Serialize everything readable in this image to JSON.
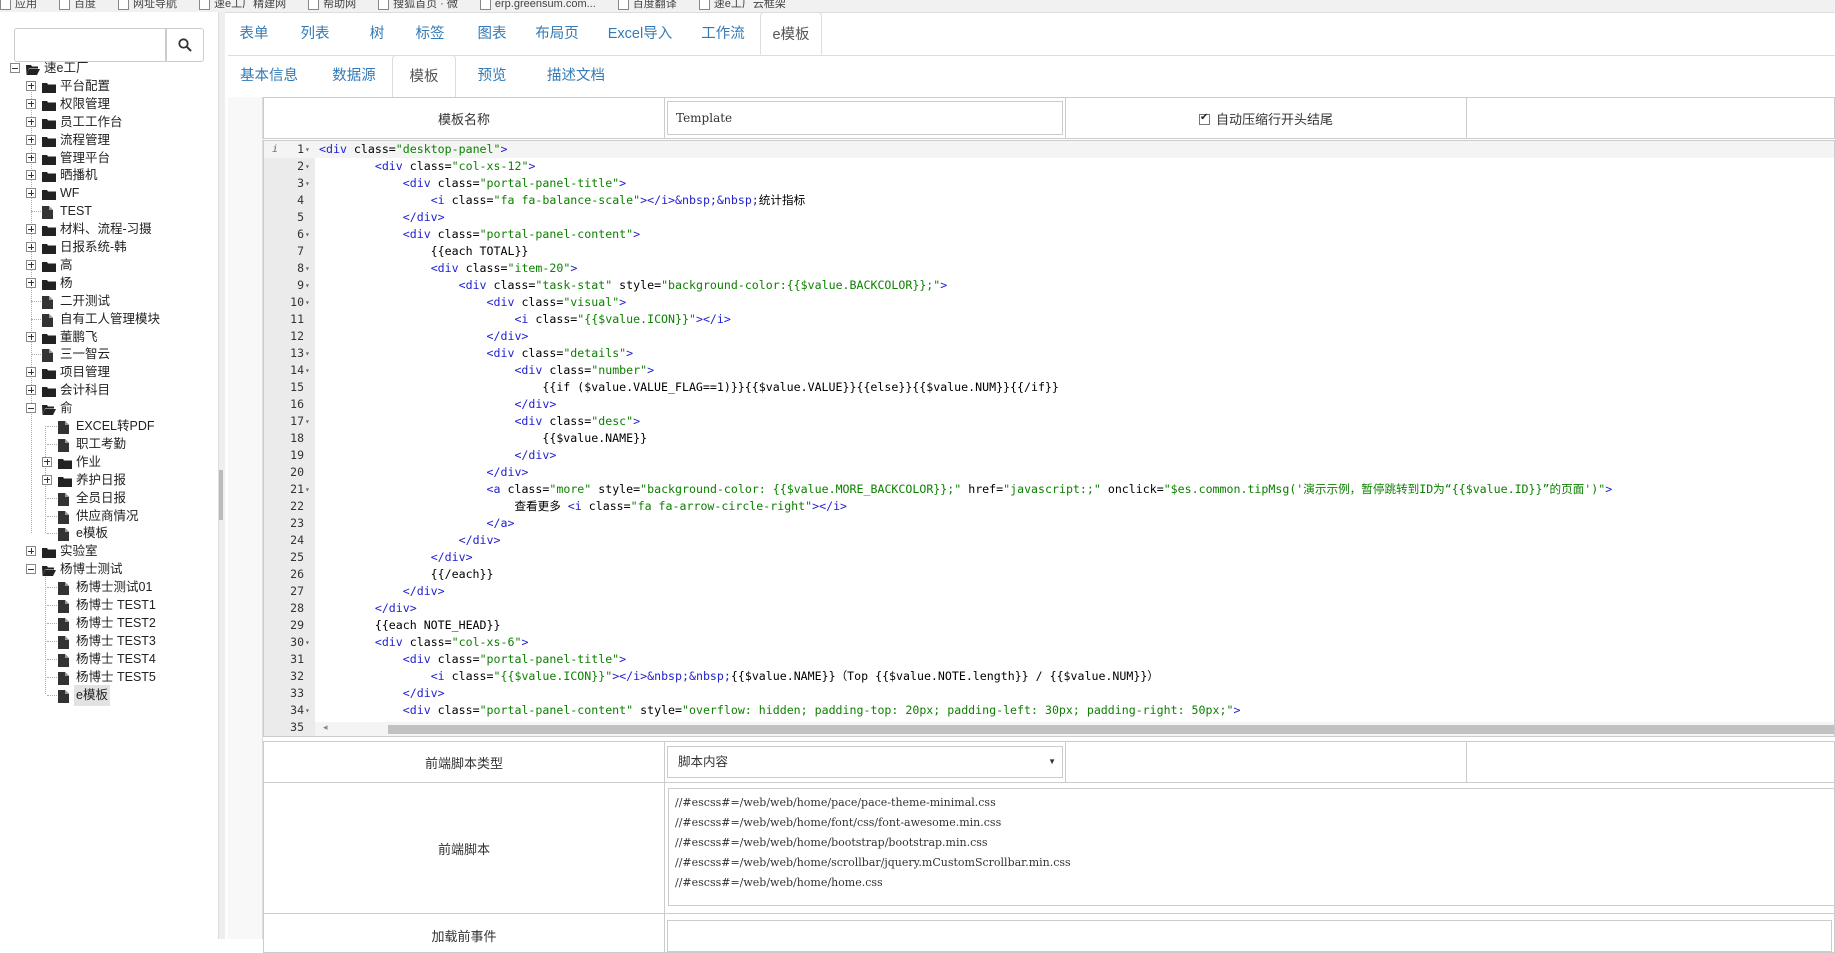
{
  "bookmarks": [
    "应用",
    "百度",
    "网址导航",
    "速e工厂精建网",
    "帮助网",
    "搜狐首页 · 微",
    "erp.greensum.com...",
    "百度翻译",
    "速e工厂云框架"
  ],
  "search": {
    "placeholder": ""
  },
  "tree": [
    {
      "label": "速e工厂",
      "icon": "folder-open",
      "toggle": "minus"
    },
    {
      "label": "平台配置",
      "icon": "folder",
      "toggle": "plus"
    },
    {
      "label": "权限管理",
      "icon": "folder",
      "toggle": "plus"
    },
    {
      "label": "员工工作台",
      "icon": "folder",
      "toggle": "plus"
    },
    {
      "label": "流程管理",
      "icon": "folder",
      "toggle": "plus"
    },
    {
      "label": "管理平台",
      "icon": "folder",
      "toggle": "plus"
    },
    {
      "label": "晒播机",
      "icon": "folder",
      "toggle": "plus"
    },
    {
      "label": "WF",
      "icon": "folder",
      "toggle": "plus"
    },
    {
      "label": "TEST",
      "icon": "file",
      "toggle": "none"
    },
    {
      "label": "材料、流程-习摄",
      "icon": "folder",
      "toggle": "plus"
    },
    {
      "label": "日报系统-韩",
      "icon": "folder",
      "toggle": "plus"
    },
    {
      "label": "高",
      "icon": "folder",
      "toggle": "plus"
    },
    {
      "label": "杨",
      "icon": "folder",
      "toggle": "plus"
    },
    {
      "label": "二开测试",
      "icon": "file",
      "toggle": "none"
    },
    {
      "label": "自有工人管理模块",
      "icon": "file",
      "toggle": "none"
    },
    {
      "label": "董鹏飞",
      "icon": "folder",
      "toggle": "plus"
    },
    {
      "label": "三一智云",
      "icon": "file",
      "toggle": "none"
    },
    {
      "label": "项目管理",
      "icon": "folder",
      "toggle": "plus"
    },
    {
      "label": "会计科目",
      "icon": "folder",
      "toggle": "plus"
    },
    {
      "label": "俞",
      "icon": "folder-open",
      "toggle": "minus"
    },
    {
      "label": "EXCEL转PDF",
      "icon": "file",
      "toggle": "none"
    },
    {
      "label": "职工考勤",
      "icon": "file",
      "toggle": "none"
    },
    {
      "label": "作业",
      "icon": "folder",
      "toggle": "plus"
    },
    {
      "label": "养护日报",
      "icon": "folder",
      "toggle": "plus"
    },
    {
      "label": "全员日报",
      "icon": "file",
      "toggle": "none"
    },
    {
      "label": "供应商情况",
      "icon": "file",
      "toggle": "none"
    },
    {
      "label": "e模板",
      "icon": "file",
      "toggle": "none"
    },
    {
      "label": "实验室",
      "icon": "folder",
      "toggle": "plus"
    },
    {
      "label": "杨博士测试",
      "icon": "folder-open",
      "toggle": "minus"
    },
    {
      "label": "杨博士测试01",
      "icon": "file",
      "toggle": "none"
    },
    {
      "label": "杨博士 TEST1",
      "icon": "file",
      "toggle": "none"
    },
    {
      "label": "杨博士 TEST2",
      "icon": "file",
      "toggle": "none"
    },
    {
      "label": "杨博士 TEST3",
      "icon": "file",
      "toggle": "none"
    },
    {
      "label": "杨博士 TEST4",
      "icon": "file",
      "toggle": "none"
    },
    {
      "label": "杨博士 TEST5",
      "icon": "file",
      "toggle": "none"
    },
    {
      "label": "e模板",
      "icon": "file",
      "toggle": "none",
      "selected": true
    }
  ],
  "main_tabs": [
    "表单",
    "列表",
    "树",
    "标签",
    "图表",
    "布局页",
    "Excel导入",
    "工作流",
    "e模板"
  ],
  "sub_tabs": [
    "基本信息",
    "数据源",
    "模板",
    "预览",
    "描述文档"
  ],
  "form": {
    "template_name_label": "模板名称",
    "template_name_value": "Template",
    "auto_compress_label": "自动压缩行开头结尾",
    "frontend_script_type_label": "前端脚本类型",
    "frontend_script_type_value": "脚本内容",
    "frontend_script_label": "前端脚本",
    "before_load_label": "加载前事件"
  },
  "frontend_script_lines": [
    "//#escss#=/web/web/home/pace/pace-theme-minimal.css",
    "//#escss#=/web/web/home/font/css/font-awesome.min.css",
    "//#escss#=/web/web/home/bootstrap/bootstrap.min.css",
    "//#escss#=/web/web/home/scrollbar/jquery.mCustomScrollbar.min.css",
    "//#escss#=/web/web/home/home.css"
  ],
  "code": {
    "line_count": 35,
    "fold_lines": [
      1,
      2,
      3,
      6,
      8,
      9,
      10,
      13,
      14,
      17,
      21,
      30,
      34
    ],
    "lines": [
      [
        [
          "tg",
          "<div "
        ],
        [
          "at",
          "class="
        ],
        [
          "st",
          "\"desktop-panel\""
        ],
        [
          "tg",
          ">"
        ]
      ],
      [
        [
          "tx",
          "        "
        ],
        [
          "tg",
          "<div "
        ],
        [
          "at",
          "class="
        ],
        [
          "st",
          "\"col-xs-12\""
        ],
        [
          "tg",
          ">"
        ]
      ],
      [
        [
          "tx",
          "            "
        ],
        [
          "tg",
          "<div "
        ],
        [
          "at",
          "class="
        ],
        [
          "st",
          "\"portal-panel-title\""
        ],
        [
          "tg",
          ">"
        ]
      ],
      [
        [
          "tx",
          "                "
        ],
        [
          "tg",
          "<i "
        ],
        [
          "at",
          "class="
        ],
        [
          "st",
          "\"fa fa-balance-scale\""
        ],
        [
          "tg",
          "></i>"
        ],
        [
          "tg",
          "&nbsp;&nbsp;"
        ],
        [
          "tx",
          "统计指标"
        ]
      ],
      [
        [
          "tx",
          "            "
        ],
        [
          "tg",
          "</div>"
        ]
      ],
      [
        [
          "tx",
          "            "
        ],
        [
          "tg",
          "<div "
        ],
        [
          "at",
          "class="
        ],
        [
          "st",
          "\"portal-panel-content\""
        ],
        [
          "tg",
          ">"
        ]
      ],
      [
        [
          "tx",
          "                {{each TOTAL}}"
        ]
      ],
      [
        [
          "tx",
          "                "
        ],
        [
          "tg",
          "<div "
        ],
        [
          "at",
          "class="
        ],
        [
          "st",
          "\"item-20\""
        ],
        [
          "tg",
          ">"
        ]
      ],
      [
        [
          "tx",
          "                    "
        ],
        [
          "tg",
          "<div "
        ],
        [
          "at",
          "class="
        ],
        [
          "st",
          "\"task-stat\""
        ],
        [
          "at",
          " style="
        ],
        [
          "st",
          "\"background-color:{{$value.BACKCOLOR}};\""
        ],
        [
          "tg",
          ">"
        ]
      ],
      [
        [
          "tx",
          "                        "
        ],
        [
          "tg",
          "<div "
        ],
        [
          "at",
          "class="
        ],
        [
          "st",
          "\"visual\""
        ],
        [
          "tg",
          ">"
        ]
      ],
      [
        [
          "tx",
          "                            "
        ],
        [
          "tg",
          "<i "
        ],
        [
          "at",
          "class="
        ],
        [
          "st",
          "\"{{$value.ICON}}\""
        ],
        [
          "tg",
          "></i>"
        ]
      ],
      [
        [
          "tx",
          "                        "
        ],
        [
          "tg",
          "</div>"
        ]
      ],
      [
        [
          "tx",
          "                        "
        ],
        [
          "tg",
          "<div "
        ],
        [
          "at",
          "class="
        ],
        [
          "st",
          "\"details\""
        ],
        [
          "tg",
          ">"
        ]
      ],
      [
        [
          "tx",
          "                            "
        ],
        [
          "tg",
          "<div "
        ],
        [
          "at",
          "class="
        ],
        [
          "st",
          "\"number\""
        ],
        [
          "tg",
          ">"
        ]
      ],
      [
        [
          "tx",
          "                                {{if ($value.VALUE_FLAG==1)}}{{$value.VALUE}}{{else}}{{$value.NUM}}{{/if}}"
        ]
      ],
      [
        [
          "tx",
          "                            "
        ],
        [
          "tg",
          "</div>"
        ]
      ],
      [
        [
          "tx",
          "                            "
        ],
        [
          "tg",
          "<div "
        ],
        [
          "at",
          "class="
        ],
        [
          "st",
          "\"desc\""
        ],
        [
          "tg",
          ">"
        ]
      ],
      [
        [
          "tx",
          "                                {{$value.NAME}}"
        ]
      ],
      [
        [
          "tx",
          "                            "
        ],
        [
          "tg",
          "</div>"
        ]
      ],
      [
        [
          "tx",
          "                        "
        ],
        [
          "tg",
          "</div>"
        ]
      ],
      [
        [
          "tx",
          "                        "
        ],
        [
          "tg",
          "<a "
        ],
        [
          "at",
          "class="
        ],
        [
          "st",
          "\"more\""
        ],
        [
          "at",
          " style="
        ],
        [
          "st",
          "\"background-color: {{$value.MORE_BACKCOLOR}};\""
        ],
        [
          "at",
          " href="
        ],
        [
          "st",
          "\"javascript:;\""
        ],
        [
          "at",
          " onclick="
        ],
        [
          "st",
          "\"$es.common.tipMsg('演示示例，暂停跳转到ID为“{{$value.ID}}”的页面')\""
        ],
        [
          "tg",
          ">"
        ]
      ],
      [
        [
          "tx",
          "                            查看更多 "
        ],
        [
          "tg",
          "<i "
        ],
        [
          "at",
          "class="
        ],
        [
          "st",
          "\"fa fa-arrow-circle-right\""
        ],
        [
          "tg",
          "></i>"
        ]
      ],
      [
        [
          "tx",
          "                        "
        ],
        [
          "tg",
          "</a>"
        ]
      ],
      [
        [
          "tx",
          "                    "
        ],
        [
          "tg",
          "</div>"
        ]
      ],
      [
        [
          "tx",
          "                "
        ],
        [
          "tg",
          "</div>"
        ]
      ],
      [
        [
          "tx",
          "                {{/each}}"
        ]
      ],
      [
        [
          "tx",
          "            "
        ],
        [
          "tg",
          "</div>"
        ]
      ],
      [
        [
          "tx",
          "        "
        ],
        [
          "tg",
          "</div>"
        ]
      ],
      [
        [
          "tx",
          "        {{each NOTE_HEAD}}"
        ]
      ],
      [
        [
          "tx",
          "        "
        ],
        [
          "tg",
          "<div "
        ],
        [
          "at",
          "class="
        ],
        [
          "st",
          "\"col-xs-6\""
        ],
        [
          "tg",
          ">"
        ]
      ],
      [
        [
          "tx",
          "            "
        ],
        [
          "tg",
          "<div "
        ],
        [
          "at",
          "class="
        ],
        [
          "st",
          "\"portal-panel-title\""
        ],
        [
          "tg",
          ">"
        ]
      ],
      [
        [
          "tx",
          "                "
        ],
        [
          "tg",
          "<i "
        ],
        [
          "at",
          "class="
        ],
        [
          "st",
          "\"{{$value.ICON}}\""
        ],
        [
          "tg",
          "></i>"
        ],
        [
          "tg",
          "&nbsp;&nbsp;"
        ],
        [
          "tx",
          "{{$value.NAME}}（Top {{$value.NOTE.length}} / {{$value.NUM}}）"
        ]
      ],
      [
        [
          "tx",
          "            "
        ],
        [
          "tg",
          "</div>"
        ]
      ],
      [
        [
          "tx",
          "            "
        ],
        [
          "tg",
          "<div "
        ],
        [
          "at",
          "class="
        ],
        [
          "st",
          "\"portal-panel-content\""
        ],
        [
          "at",
          " style="
        ],
        [
          "st",
          "\"overflow: hidden; padding-top: 20px; padding-left: 30px; padding-right: 50px;\""
        ],
        [
          "tg",
          ">"
        ]
      ],
      [
        [
          "tx",
          ""
        ]
      ]
    ]
  },
  "colors": {
    "link": "#337ab7",
    "tag": "#1e1ed2",
    "string": "#0d8000",
    "gutter": "#ebebeb"
  },
  "icons": {
    "search": "search-icon",
    "folder": "folder-icon",
    "file": "file-icon",
    "info": "info-icon",
    "select_arrow": "chevron-down-icon"
  }
}
